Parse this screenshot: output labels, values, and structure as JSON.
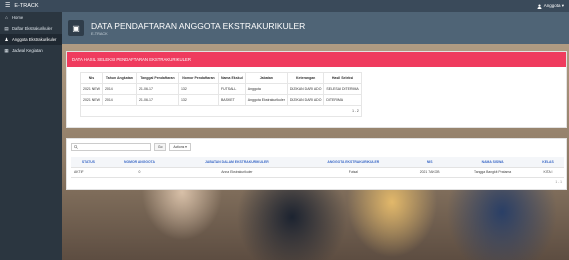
{
  "topbar": {
    "menu_icon": "☰",
    "app_name": "E-TRACK",
    "user_icon": "user-icon",
    "user_name": "Anggota ▾"
  },
  "sidebar": {
    "items": [
      {
        "icon": "⌂",
        "icon_name": "home-icon",
        "label": "Home",
        "active": false
      },
      {
        "icon": "▤",
        "icon_name": "list-icon",
        "label": "Daftar Ekstrakurikuler",
        "active": false
      },
      {
        "icon": "♟",
        "icon_name": "user-icon",
        "label": "Anggota Ekstrakurikuler",
        "active": true
      },
      {
        "icon": "▦",
        "icon_name": "calendar-icon",
        "label": "Jadwal Kegiatan",
        "active": false
      }
    ]
  },
  "header": {
    "icon": "▣",
    "title": "DATA PENDAFTARAN ANGGOTA EKSTRAKURIKULER",
    "subtitle": "E-TRACK"
  },
  "panel1": {
    "title": "DATA HASIL SELEKSI PENDAFTARAN EKSTRAKURIKULER",
    "columns": [
      "Nis",
      "Tahun Angkatan",
      "Tanggal Pendaftaran",
      "Nomor Pendaftaran",
      "Nama Ekskul",
      "Jabatan",
      "Keterangan",
      "Hasil Seleksi"
    ],
    "rows": [
      [
        "2021 NEW",
        "2014",
        "21-06-17",
        "132",
        "FUTSALL",
        "Anggota",
        "DIZIKAN DARI ADO",
        "SELESAI DITERIMA"
      ],
      [
        "2021 NEW",
        "2014",
        "21-06-17",
        "132",
        "BASKET",
        "Anggota Ekstrakurikuler",
        "DIZIKAN DARI ADO",
        "DITERIMA"
      ]
    ],
    "pagination": "1 - 2"
  },
  "panel2": {
    "search_placeholder": "",
    "search_icon": "search-icon",
    "go_label": "Go",
    "actions_label": "Actions ▾",
    "columns": [
      "STATUS",
      "NOMOR ANGGOTA",
      "JABATAN DALAM EKSTRAKURIKULER",
      "ANGGOTA EKSTRAKURIKULER",
      "NIS",
      "NAMA SISWA",
      "KELAS"
    ],
    "rows": [
      [
        "AKTIF",
        "0",
        "Anna Ekstrakurikuler",
        "Futsal",
        "2021 7AKOB",
        "Tangga Bangkit Pratama",
        "KITA I"
      ]
    ],
    "pagination": "1 - 1"
  }
}
